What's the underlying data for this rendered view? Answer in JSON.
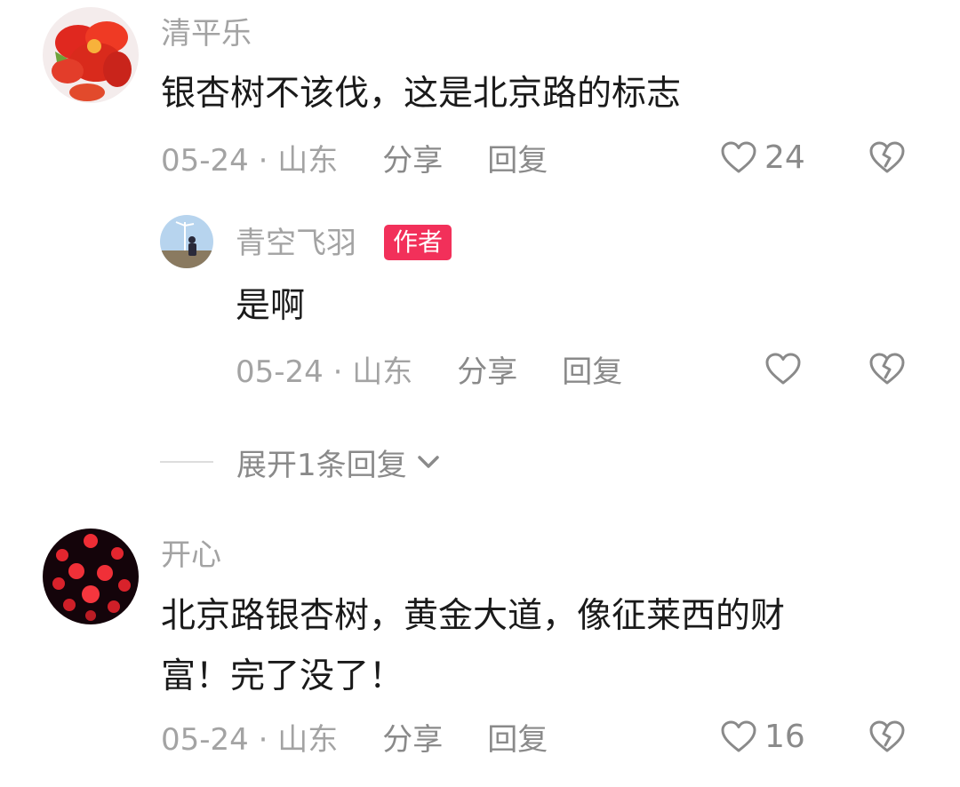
{
  "comments": [
    {
      "username": "清平乐",
      "text_lines": [
        "银杏树不该伐，这是北京路的标志"
      ],
      "meta": "05-24 · 山东",
      "share_label": "分享",
      "reply_label": "回复",
      "like_count": "24"
    },
    {
      "username": "开心",
      "text_lines": [
        "北京路银杏树，黄金大道，像征莱西的财",
        "富！完了没了！"
      ],
      "meta": "05-24 · 山东",
      "share_label": "分享",
      "reply_label": "回复",
      "like_count": "16"
    }
  ],
  "reply": {
    "username": "青空飞羽",
    "badge": "作者",
    "text": "是啊",
    "meta": "05-24 · 山东",
    "share_label": "分享",
    "reply_label": "回复"
  },
  "expand_label": "展开1条回复",
  "colors": {
    "badge": "#f2305a",
    "muted_text": "#a3a3a3",
    "body_text": "#1a1a1a"
  }
}
